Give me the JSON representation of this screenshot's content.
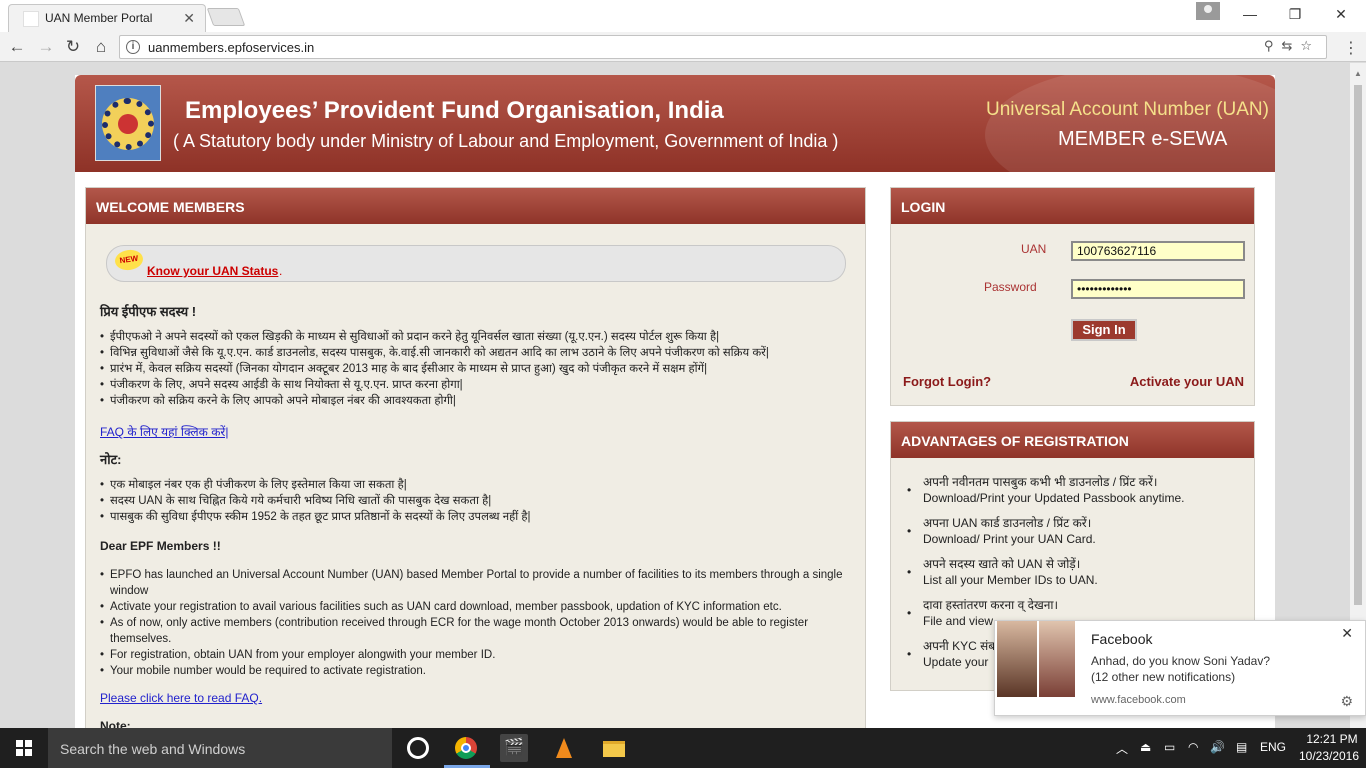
{
  "browser": {
    "tab_title": "UAN Member Portal",
    "url": "uanmembers.epfoservices.in"
  },
  "banner": {
    "title": "Employees’ Provident Fund Organisation, India",
    "subtitle": "( A Statutory body under Ministry of Labour and Employment, Government of India )",
    "uan_title": "Universal Account Number (UAN)",
    "esewa_title": "MEMBER  e-SEWA"
  },
  "welcome": {
    "heading": "WELCOME MEMBERS",
    "new_badge": "NEW",
    "uan_status_link": "Know your UAN Status",
    "hindi_heading": "प्रिय ईपीएफ सदस्य !",
    "hindi_points": [
      "ईपीएफओ ने अपने सदस्यों को एकल खिड़की के माध्यम से सुविधाओं को प्रदान करने हेतु यूनिवर्सल खाता संख्या (यू.ए.एन.) सदस्य पोर्टल शुरू किया है|",
      "विभिन्न सुविधाओं जैसे कि यू.ए.एन. कार्ड डाउनलोड, सदस्य पासबुक, के.वाई.सी जानकारी को अद्यतन आदि का लाभ उठाने के लिए अपने पंजीकरण को सक्रिय करें|",
      "प्रारंभ में, केवल सक्रिय सदस्यों (जिनका योगदान अक्टूबर 2013 माह के बाद ईसीआर के माध्यम से प्राप्त हुआ) खुद को पंजीकृत करने में सक्षम होंगें|",
      "पंजीकरण के लिए, अपने सदस्य आईडी के साथ नियोक्ता से यू.ए.एन. प्राप्त करना होगा|",
      "पंजीकरण को सक्रिय करने के लिए आपको अपने मोबाइल नंबर की आवश्यकता होगी|"
    ],
    "hindi_faq_link": "FAQ के लिए यहां क्लिक करें|",
    "note_heading": "नोट:",
    "hindi_notes": [
      "एक मोबाइल नंबर एक ही पंजीकरण के लिए इस्तेमाल किया जा सकता है|",
      "सदस्य UAN के साथ चिह्नित किये गये कर्मचारी भविष्य निधि खातों की पासबुक देख सकता है|",
      "पासबुक की सुविधा ईपीएफ स्कीम 1952 के तहत छूट प्राप्त प्रतिष्ठानों के सदस्यों के लिए उपलब्ध नहीं है|"
    ],
    "english_heading": "Dear EPF Members !!",
    "english_points": [
      "EPFO has launched an Universal Account Number (UAN) based Member Portal to provide a number of facilities to its members through a single window",
      "Activate your registration to avail various facilities such as UAN card download, member passbook, updation of KYC information etc.",
      "As of now, only active members (contribution received through ECR for the wage month October 2013 onwards) would be able to register themselves.",
      "For registration, obtain UAN from your employer alongwith your member ID.",
      "Your mobile number would be required to activate registration."
    ],
    "english_faq_link": "Please click here to read FAQ.",
    "english_note_heading": "Note:"
  },
  "login": {
    "heading": "LOGIN",
    "uan_label": "UAN",
    "uan_value": "100763627116",
    "password_label": "Password",
    "password_value": "•••••••••••••",
    "signin_label": "Sign In",
    "forgot_label": "Forgot Login?",
    "activate_label": "Activate your UAN"
  },
  "advantages": {
    "heading": "ADVANTAGES OF REGISTRATION",
    "items": [
      {
        "hi": "अपनी नवीनतम पासबुक कभी भी डाउनलोड / प्रिंट करें।",
        "en": "Download/Print your Updated Passbook anytime."
      },
      {
        "hi": "अपना UAN कार्ड डाउनलोड / प्रिंट करें।",
        "en": "Download/ Print your UAN Card."
      },
      {
        "hi": "अपने सदस्य खाते को UAN से जोड़ें।",
        "en": "List all your Member IDs to UAN."
      },
      {
        "hi": "दावा हस्तांतरण करना व् देखना।",
        "en": "File and view"
      },
      {
        "hi": "अपनी KYC संब",
        "en": "Update your"
      }
    ]
  },
  "notification": {
    "title": "Facebook",
    "line1": "Anhad, do you know Soni Yadav?",
    "line2": "(12 other new notifications)",
    "source": "www.facebook.com"
  },
  "taskbar": {
    "search_placeholder": "Search the web and Windows",
    "language": "ENG",
    "time": "12:21 PM",
    "date": "10/23/2016"
  }
}
